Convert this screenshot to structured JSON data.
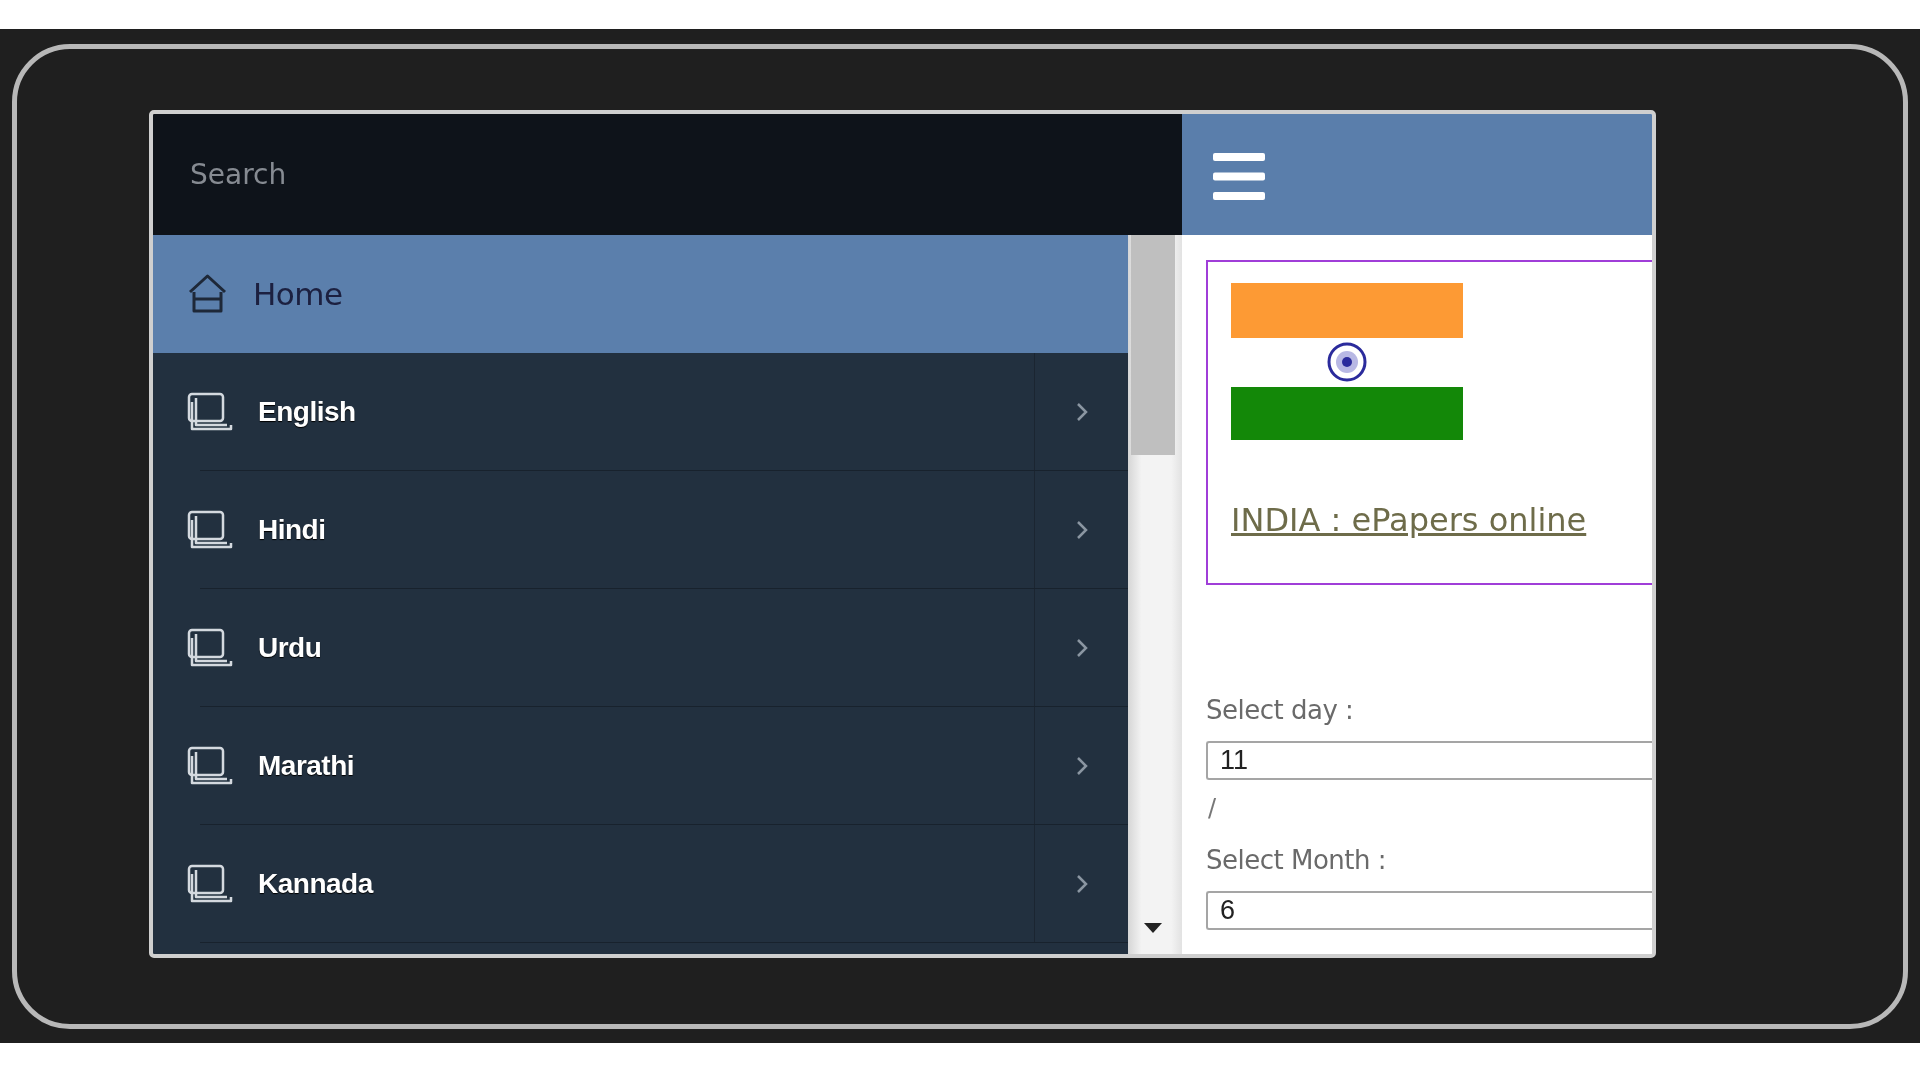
{
  "search": {
    "placeholder": "Search"
  },
  "menu": [
    {
      "label": "Home",
      "kind": "home",
      "selected": true
    },
    {
      "label": "English",
      "kind": "language",
      "selected": false
    },
    {
      "label": "Hindi",
      "kind": "language",
      "selected": false
    },
    {
      "label": "Urdu",
      "kind": "language",
      "selected": false
    },
    {
      "label": "Marathi",
      "kind": "language",
      "selected": false
    },
    {
      "label": "Kannada",
      "kind": "language",
      "selected": false
    }
  ],
  "banner": {
    "link": "INDIA : ePapers online"
  },
  "date_form": [
    {
      "label": "Select day :",
      "value": "11",
      "separator": "/"
    },
    {
      "label": "Select Month :",
      "value": "6"
    }
  ]
}
